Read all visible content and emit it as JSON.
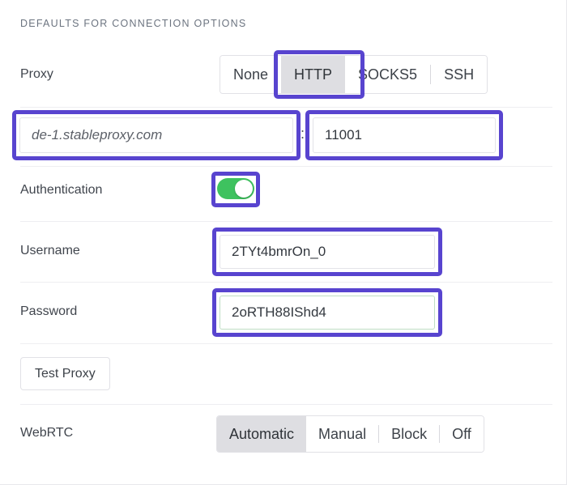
{
  "section": {
    "header": "DEFAULTS FOR CONNECTION OPTIONS"
  },
  "colors": {
    "highlight": "#5844CF",
    "toggle_on": "#3EC25F",
    "segment_selected_bg": "#DEDEE2",
    "password_border": "#BFDDC4"
  },
  "proxy": {
    "label": "Proxy",
    "options": [
      "None",
      "HTTP",
      "SOCKS5",
      "SSH"
    ],
    "selected": "HTTP",
    "host": {
      "value": "",
      "placeholder": "de-1.stableproxy.com"
    },
    "separator": ":",
    "port": {
      "value": "11001",
      "placeholder": ""
    }
  },
  "authentication": {
    "label": "Authentication",
    "enabled": true,
    "state_text": "on"
  },
  "username": {
    "label": "Username",
    "value": "2TYt4bmrOn_0"
  },
  "password": {
    "label": "Password",
    "value": "2oRTH88IShd4"
  },
  "test_proxy": {
    "label": "Test Proxy"
  },
  "webrtc": {
    "label": "WebRTC",
    "options": [
      "Automatic",
      "Manual",
      "Block",
      "Off"
    ],
    "selected": "Automatic"
  }
}
